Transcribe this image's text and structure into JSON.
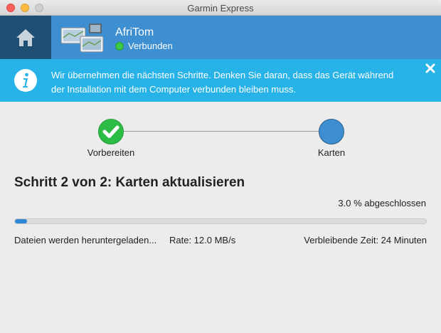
{
  "window": {
    "title": "Garmin Express"
  },
  "header": {
    "device_name": "AfriTom",
    "status": "Verbunden",
    "status_color": "#3ac948",
    "background_color": "#3d8fd1",
    "home_icon": "home-icon"
  },
  "banner": {
    "message": "Wir übernehmen die nächsten Schritte. Denken Sie daran, dass das Gerät während der Installation mit dem Computer verbunden bleiben muss.",
    "icon": "info-icon",
    "close_icon": "close-icon",
    "background_color": "#27b2e8"
  },
  "steps": [
    {
      "label": "Vorbereiten",
      "state": "done"
    },
    {
      "label": "Karten",
      "state": "current"
    }
  ],
  "main": {
    "heading": "Schritt 2 von 2: Karten aktualisieren",
    "percent_text": "3.0 % abgeschlossen",
    "progress_fraction": 0.03,
    "status_text": "Dateien werden heruntergeladen...",
    "rate_text": "Rate: 12.0 MB/s",
    "remaining_text": "Verbleibende Zeit: 24 Minuten"
  }
}
